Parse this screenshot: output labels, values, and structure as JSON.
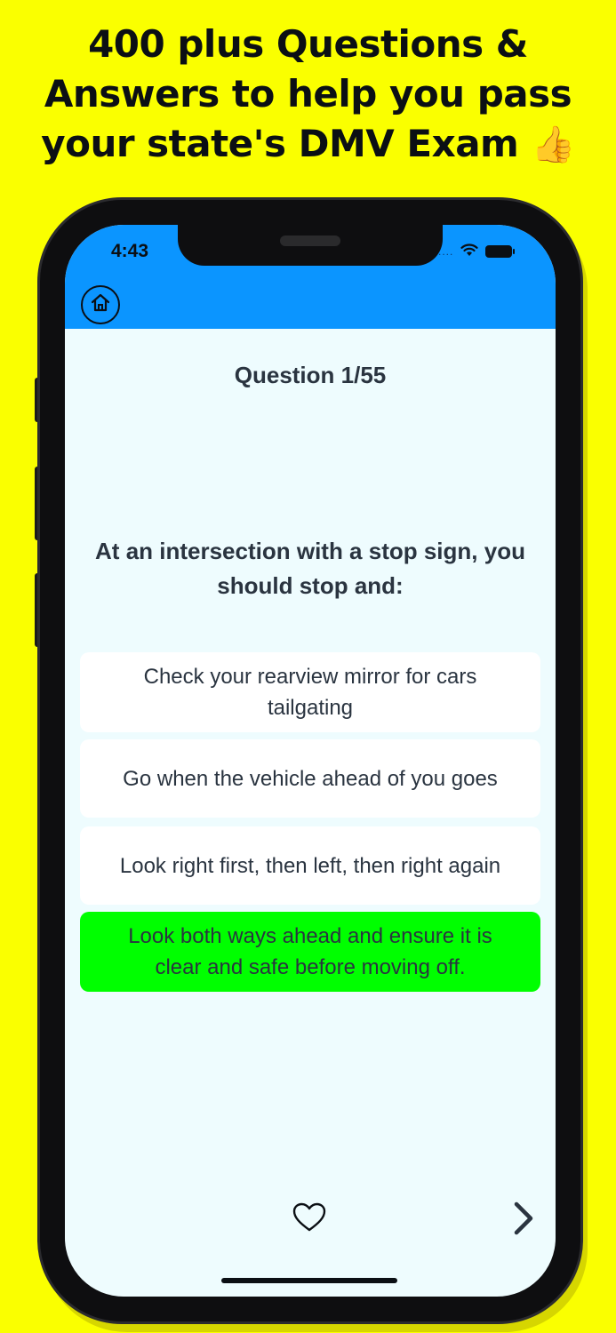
{
  "promo": {
    "line1": "400 plus Questions &",
    "line2": "Answers to help you pass",
    "line3": "your state's DMV Exam",
    "emoji": "👍"
  },
  "status_bar": {
    "time": "4:43",
    "dots": "....",
    "icons": [
      "wifi-icon",
      "battery-icon"
    ]
  },
  "header": {
    "home_icon": "home-icon",
    "color": "#0b95ff"
  },
  "quiz": {
    "question_number": "Question 1/55",
    "question": "At an intersection with a stop sign, you should stop and:",
    "answers": [
      {
        "text": "Check your rearview mirror for cars tailgating",
        "state": "default"
      },
      {
        "text": "Go when the vehicle ahead of you goes",
        "state": "default"
      },
      {
        "text": "Look right first, then left, then right again",
        "state": "default"
      },
      {
        "text": "Look both ways ahead and ensure it is clear and safe before moving off.",
        "state": "correct"
      }
    ]
  },
  "footer": {
    "favorite_icon": "heart-icon",
    "next_icon": "chevron-right-icon"
  },
  "colors": {
    "background": "#faff00",
    "correct": "#00ff00",
    "screen": "#eefcfe",
    "text": "#2a3440"
  }
}
